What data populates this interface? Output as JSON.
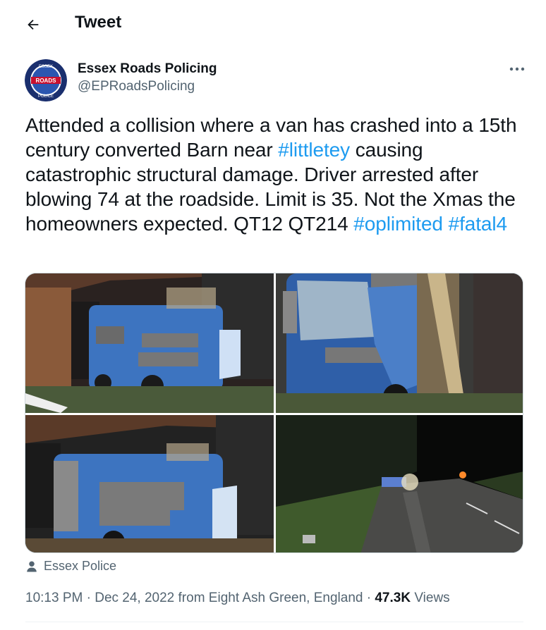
{
  "header": {
    "title": "Tweet",
    "back_icon": "arrow-left-icon"
  },
  "author": {
    "name": "Essex Roads Policing",
    "handle": "@EPRoadsPolicing",
    "avatar_text_top": "ESSEX",
    "avatar_text_mid": "ROADS",
    "avatar_text_bottom": "POLICE"
  },
  "tweet": {
    "text_1": "Attended a collision where a van has crashed into a 15th century converted Barn near ",
    "hashtag_1": "#littletey",
    "text_2": " causing catastrophic structural damage. Driver arrested after blowing 74 at the roadside. Limit is 35. Not the Xmas the homeowners expected. QT12 QT214 ",
    "hashtag_2": "#oplimited",
    "text_3": " ",
    "hashtag_3": "#fatal4"
  },
  "tagged": {
    "label": "Essex Police",
    "icon": "person-icon"
  },
  "meta": {
    "time": "10:13 PM",
    "separator": " · ",
    "date": "Dec 24, 2022",
    "location": " from Eight Ash Green, England",
    "views_count": "47.3K",
    "views_label": " Views"
  },
  "colors": {
    "link": "#1d9bf0",
    "secondary_text": "#536471",
    "van_blue": "#3d74c0"
  }
}
